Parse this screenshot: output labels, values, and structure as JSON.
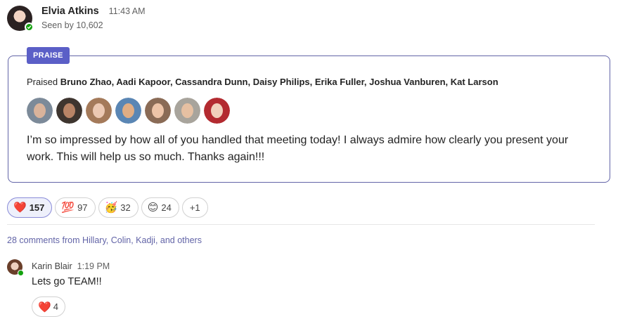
{
  "post": {
    "author": "Elvia Atkins",
    "time": "11:43 AM",
    "seen_by": "Seen by 10,602"
  },
  "praise": {
    "tag": "PRAISE",
    "prefix": "Praised",
    "names": "Bruno Zhao, Aadi Kapoor, Cassandra Dunn, Daisy Philips, Erika Fuller, Joshua Vanburen, Kat Larson",
    "message": "I’m so impressed by how all of you handled that meeting today! I always admire how clearly you present your work. This will help us so much. Thanks again!!!",
    "people": [
      "Bruno Zhao",
      "Aadi Kapoor",
      "Cassandra Dunn",
      "Daisy Philips",
      "Erika Fuller",
      "Joshua Vanburen",
      "Kat Larson"
    ]
  },
  "reactions": [
    {
      "emoji": "❤️",
      "icon": "heart-icon",
      "count": "157",
      "active": true
    },
    {
      "emoji": "💯",
      "icon": "hundred-points-icon",
      "count": "97"
    },
    {
      "emoji": "🥳",
      "icon": "party-face-icon",
      "count": "32"
    },
    {
      "emoji": "😊",
      "icon": "smiling-face-icon",
      "count": "24"
    },
    {
      "label": "+1"
    }
  ],
  "comments_summary": "28 comments from Hillary, Colin, Kadji, and others",
  "comment": {
    "author": "Karin Blair",
    "time": "1:19 PM",
    "text": "Lets go TEAM!!",
    "reaction": {
      "emoji": "❤️",
      "icon": "heart-icon",
      "count": "4"
    }
  },
  "colors": {
    "accent": "#6264a7",
    "tag_bg": "#5b5fc7",
    "presence": "#13a10e"
  }
}
